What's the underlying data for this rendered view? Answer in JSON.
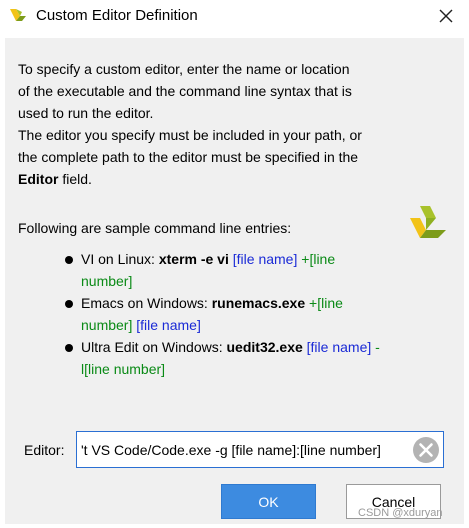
{
  "window": {
    "title": "Custom Editor Definition",
    "close_icon": "close-icon"
  },
  "intro": {
    "line1": "To specify a custom editor, enter the name or location",
    "line2": "of the executable and the command line syntax that is",
    "line3": "used to run the editor.",
    "line4": "The editor you specify must be included in your path, or",
    "line5": "the complete path to the editor must be specified in the",
    "line6_bold": "Editor",
    "line6_rest": " field."
  },
  "samples": {
    "heading": "Following are sample command line entries:",
    "entries": [
      {
        "prefix": "VI on Linux: ",
        "cmd": "xterm -e vi",
        "file": " [file name]",
        "line_prefix": " +",
        "line": "[line number]"
      },
      {
        "prefix": "Emacs on Windows: ",
        "cmd": "runemacs.exe",
        "line_prefix": " +",
        "line": "[line number]",
        "file": " [file name]"
      },
      {
        "prefix": "Ultra Edit on Windows: ",
        "cmd": "uedit32.exe",
        "file": " [file name]",
        "line_prefix": " -l",
        "line": "[line number]"
      }
    ]
  },
  "editor": {
    "label": "Editor:",
    "value": "'t VS Code/Code.exe -g [file name]:[line number]"
  },
  "buttons": {
    "ok": "OK",
    "cancel": "Cancel"
  },
  "watermark": "CSDN @xduryan",
  "colors": {
    "accent": "#3d8be0",
    "link_blue": "#1a2ad6",
    "link_green": "#0a8a16",
    "logo_green": "#7d9c1a",
    "logo_yellow": "#f2c318"
  }
}
